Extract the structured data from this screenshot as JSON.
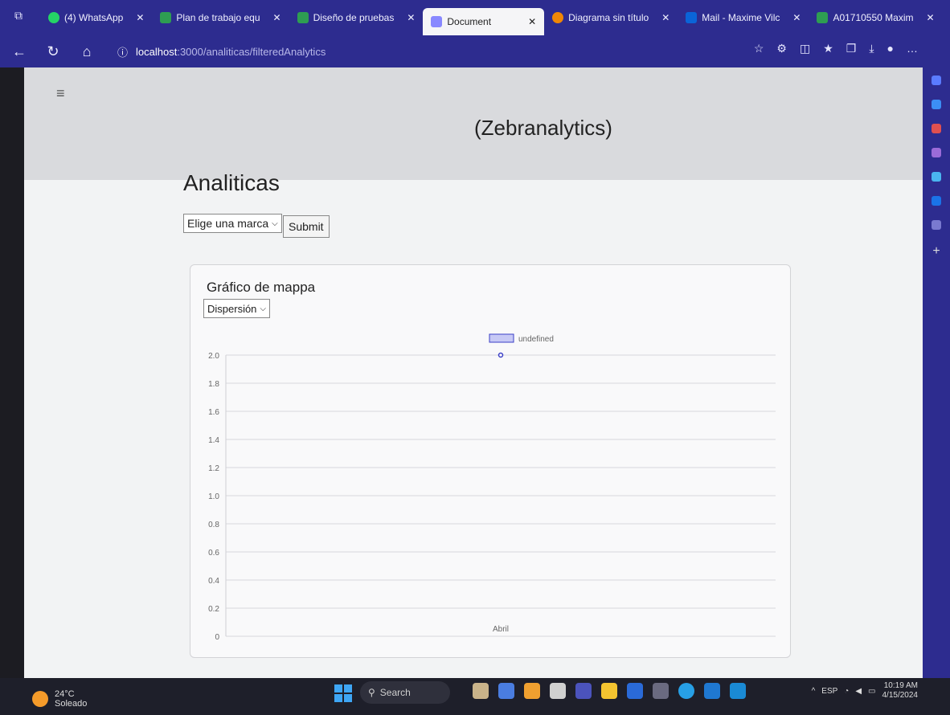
{
  "browser": {
    "tabs": [
      {
        "label": "(4) WhatsApp",
        "icon": "whatsapp-icon",
        "color": "#25d366",
        "active": false
      },
      {
        "label": "Plan de trabajo equ",
        "icon": "sheets-icon",
        "color": "#2e9d52",
        "active": false
      },
      {
        "label": "Diseño de pruebas",
        "icon": "sheets-icon",
        "color": "#2e9d52",
        "active": false
      },
      {
        "label": "Document",
        "icon": "document-icon",
        "color": "#8888ff",
        "active": true
      },
      {
        "label": "Diagrama sin título",
        "icon": "drawio-icon",
        "color": "#f08705",
        "active": false
      },
      {
        "label": "Mail - Maxime Vilc",
        "icon": "outlook-icon",
        "color": "#0a64d8",
        "active": false
      },
      {
        "label": "A01710550 Maxim",
        "icon": "sheets-icon",
        "color": "#2e9d52",
        "active": false
      }
    ],
    "url_host": "localhost",
    "url_path": ":3000/analiticas/filteredAnalytics"
  },
  "app": {
    "brand": "(Zebranalytics)",
    "page_title": "Analiticas",
    "brand_select_value": "Elige una marca",
    "submit_label": "Submit",
    "chart_card": {
      "title": "Gráfico de mappa",
      "type_select_value": "Dispersión"
    }
  },
  "chart_data": {
    "type": "scatter",
    "categories": [
      "Abril"
    ],
    "series": [
      {
        "name": "undefined",
        "values": [
          2.0
        ]
      }
    ],
    "ylim": [
      0,
      2.0
    ],
    "yticks": [
      "0",
      "0.2",
      "0.4",
      "0.6",
      "0.8",
      "1.0",
      "1.2",
      "1.4",
      "1.6",
      "1.8",
      "2.0"
    ],
    "grid": true,
    "legend": "top",
    "series_color": "#3b3fc6"
  },
  "taskbar": {
    "weather_temp": "24°C",
    "weather_desc": "Soleado",
    "search_label": "Search",
    "lang": "ESP",
    "time": "10:19 AM",
    "date": "4/15/2024"
  }
}
